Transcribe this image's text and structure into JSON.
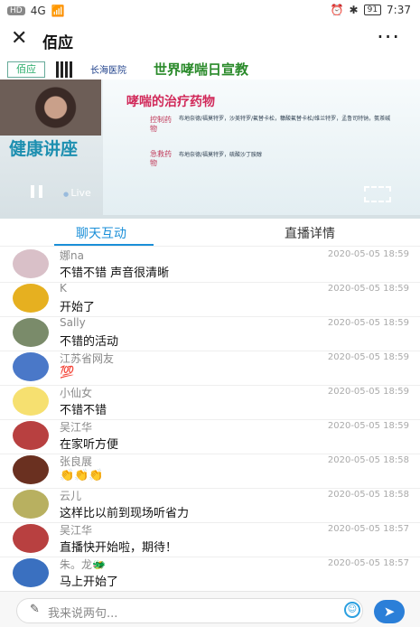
{
  "status_bar": {
    "network": "HD",
    "signal": "4G",
    "bluetooth": "✱",
    "alarm": "⏰",
    "battery": "91",
    "time": "7:37"
  },
  "app": {
    "title": "佰应",
    "close_icon": "close-icon",
    "more_icon": "more-icon"
  },
  "video": {
    "banner_logo": "佰应",
    "banner_hospital": "长海医院",
    "banner_title": "世界哮喘日宣教",
    "lecture": "健康讲座",
    "slide_title": "哮喘的治疗药物",
    "slide_items": [
      {
        "label": "控制药物",
        "text": "布地奈德/福莫特罗，沙美特罗/氟替卡松，糠酸氟替卡松/维兰特罗，孟鲁司特钠，氨茶碱"
      },
      {
        "label": "急救药物",
        "text": "布地奈德/福莫特罗，硫酸沙丁胺醇"
      }
    ],
    "live_label": "Live"
  },
  "tabs": [
    {
      "label": "聊天互动",
      "active": true
    },
    {
      "label": "直播详情",
      "active": false
    }
  ],
  "messages": [
    {
      "name": "娜na",
      "text": "不错不错 声音很清晰",
      "time": "2020-05-05 18:59",
      "avatar": "#d9c0c8"
    },
    {
      "name": "K",
      "text": "开始了",
      "time": "2020-05-05 18:59",
      "avatar": "#e6b020"
    },
    {
      "name": "Sally",
      "text": "不错的活动",
      "time": "2020-05-05 18:59",
      "avatar": "#7a8b6a"
    },
    {
      "name": "江苏省网友",
      "text": "💯",
      "time": "2020-05-05 18:59",
      "avatar": "#4a78c8"
    },
    {
      "name": "小仙女",
      "text": "不错不错",
      "time": "2020-05-05 18:59",
      "avatar": "#f6e070"
    },
    {
      "name": "吴江华",
      "text": "在家听方便",
      "time": "2020-05-05 18:59",
      "avatar": "#b84040"
    },
    {
      "name": "张良展",
      "text": "👏👏👏",
      "time": "2020-05-05 18:58",
      "avatar": "#6a3020"
    },
    {
      "name": "云儿",
      "text": "这样比以前到现场听省力",
      "time": "2020-05-05 18:58",
      "avatar": "#b8b060"
    },
    {
      "name": "吴江华",
      "text": "直播快开始啦，期待！",
      "time": "2020-05-05 18:57",
      "avatar": "#b84040"
    },
    {
      "name": "朱。龙🐲",
      "text": "马上开始了",
      "time": "2020-05-05 18:57",
      "avatar": "#3a70c0"
    }
  ],
  "input": {
    "placeholder": "我来说两句...",
    "emoji_icon": "emoji-icon",
    "send_icon": "send-icon"
  },
  "colors": {
    "accent": "#1b8fd8",
    "send": "#2b7fd8"
  }
}
